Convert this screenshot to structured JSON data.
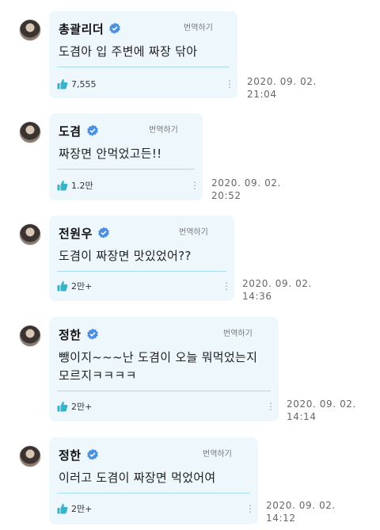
{
  "translate_label": "번역하기",
  "comments": [
    {
      "name": "총괄리더",
      "text": "도겸아 입 주변에 짜장 닦아",
      "likes": "7,555",
      "date": "2020. 09. 02.",
      "time": "21:04"
    },
    {
      "name": "도겸",
      "text": "짜장면 안먹었고든!!",
      "likes": "1.2만",
      "date": "2020. 09. 02.",
      "time": "20:52"
    },
    {
      "name": "전원우",
      "text": "도겸이 짜장면 맛있었어??",
      "likes": "2만+",
      "date": "2020. 09. 02.",
      "time": "14:36"
    },
    {
      "name": "정한",
      "text": "뺑이지~~~난 도겸이 오늘 뭐먹었는지 모르지ㅋㅋㅋㅋ",
      "likes": "2만+",
      "date": "2020. 09. 02.",
      "time": "14:14"
    },
    {
      "name": "정한",
      "text": "이러고 도겸이 짜장면 먹었어여",
      "likes": "2만+",
      "date": "2020. 09. 02.",
      "time": "14:12"
    }
  ],
  "icons": {
    "verified": "verified-badge-icon",
    "like": "thumbs-up-icon",
    "more": "more-vertical-icon"
  },
  "colors": {
    "bubble": "#eef7fc",
    "accent": "#36b3c9",
    "divider": "#a9dcf0"
  }
}
